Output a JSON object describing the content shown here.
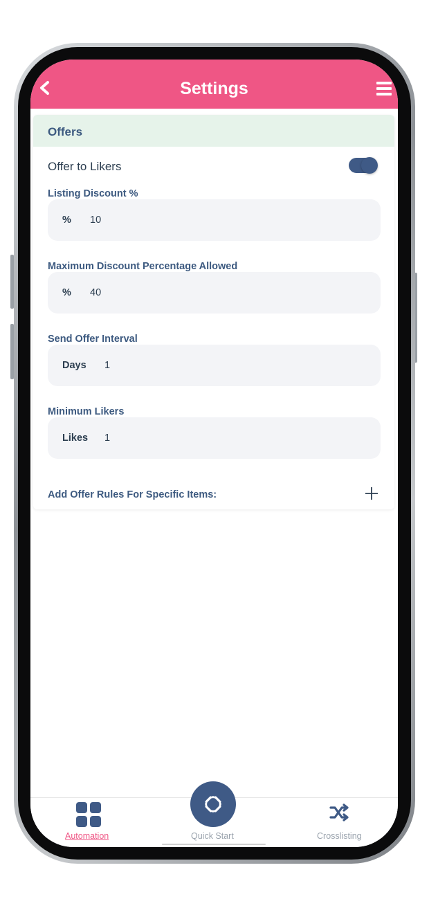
{
  "header": {
    "title": "Settings",
    "back_icon": "chevron-left-icon",
    "menu_icon": "hamburger-menu-icon"
  },
  "section": {
    "title": "Offers"
  },
  "toggle": {
    "label": "Offer to Likers",
    "on": true
  },
  "fields": [
    {
      "label": "Listing Discount %",
      "unit": "%",
      "value": "10"
    },
    {
      "label": "Maximum Discount Percentage Allowed",
      "unit": "%",
      "value": "40"
    },
    {
      "label": "Send Offer Interval",
      "unit": "Days",
      "value": "1"
    },
    {
      "label": "Minimum Likers",
      "unit": "Likes",
      "value": "1"
    }
  ],
  "rules": {
    "label": "Add Offer Rules For Specific Items:",
    "icon": "plus-icon"
  },
  "nav": {
    "automation": {
      "label": "Automation",
      "icon": "grid-icon"
    },
    "quick_start": {
      "label": "Quick Start",
      "icon": "quick-start-icon"
    },
    "crosslisting": {
      "label": "Crosslisting",
      "icon": "shuffle-icon"
    }
  },
  "colors": {
    "brand": "#ef5685",
    "accent": "#3f5a86",
    "section_bg": "#e6f3ea"
  }
}
